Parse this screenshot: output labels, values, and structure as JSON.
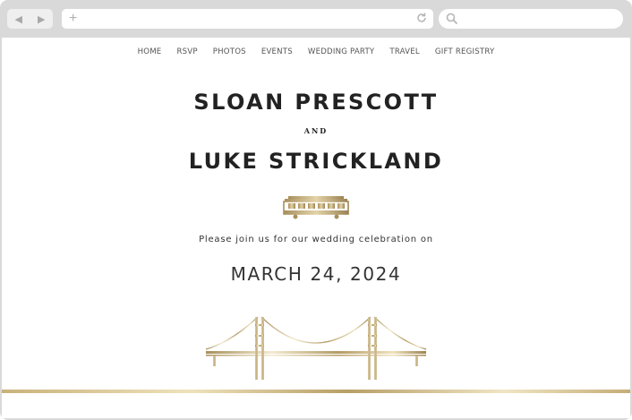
{
  "browser": {
    "back_icon": "◀",
    "forward_icon": "▶",
    "new_tab_icon": "+",
    "url": "",
    "search_value": ""
  },
  "nav": {
    "items": [
      "HOME",
      "RSVP",
      "PHOTOS",
      "EVENTS",
      "WEDDING PARTY",
      "TRAVEL",
      "GIFT REGISTRY"
    ]
  },
  "couple": {
    "name1": "SLOAN PRESCOTT",
    "joiner": "AND",
    "name2": "LUKE STRICKLAND"
  },
  "invitation": "Please join us for our wedding celebration on",
  "date": "MARCH 24, 2024",
  "colors": {
    "gold": "#c9b27a",
    "text_dark": "#222222",
    "chrome": "#d9d9d9"
  },
  "icons": {
    "illustration_top": "cable-car-icon",
    "illustration_bottom": "golden-gate-bridge-icon"
  }
}
